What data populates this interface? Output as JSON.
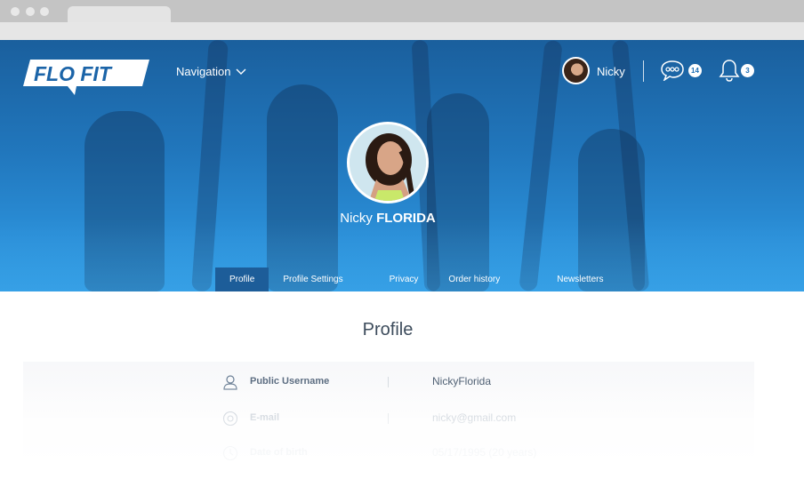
{
  "brand": {
    "logo_text": "FLO FIT"
  },
  "header": {
    "nav_label": "Navigation",
    "user_name": "Nicky",
    "messages_count": "14",
    "notifications_count": "3"
  },
  "profile": {
    "first_name": "Nicky",
    "last_name": "FLORIDA"
  },
  "tabs": [
    {
      "label": "Profile"
    },
    {
      "label": "Profile Settings"
    },
    {
      "label": "Privacy"
    },
    {
      "label": "Order history"
    },
    {
      "label": "Newsletters"
    }
  ],
  "main": {
    "title": "Profile",
    "fields": [
      {
        "label": "Public Username",
        "value": "NickyFlorida",
        "icon": "user-icon"
      },
      {
        "label": "E-mail",
        "value": "nicky@gmail.com",
        "icon": "at-icon"
      },
      {
        "label": "Date of birth",
        "value": "05/17/1995 (20 years)",
        "icon": "clock-icon"
      }
    ]
  },
  "colors": {
    "hero_blue": "#2177bd",
    "tab_active": "#1d5d99",
    "text_dark": "#3d4c5c"
  }
}
